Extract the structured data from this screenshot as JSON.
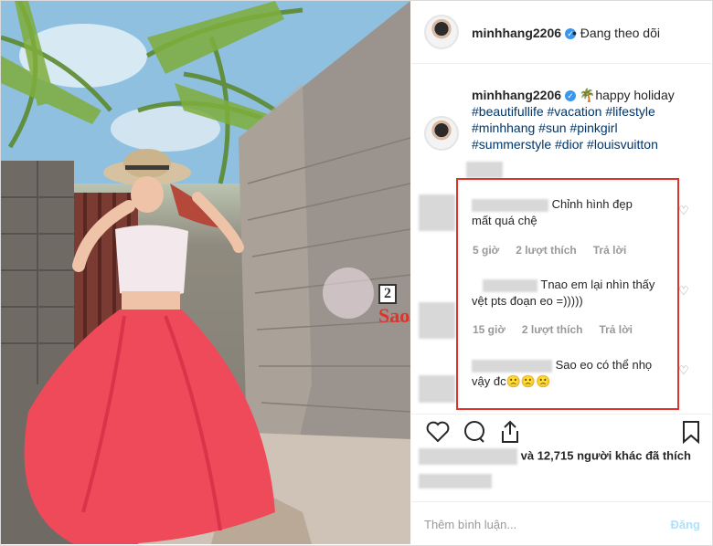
{
  "post": {
    "username": "minhhang2206",
    "follow_status": "• Đang theo dõi",
    "caption_prefix": "🌴happy holiday",
    "hashtags_line1": "#beautifullife #vacation #lifestyle",
    "hashtags_line2": "#minhhang #sun #pinkgirl",
    "hashtags_line3": "#summerstyle #dior #louisvuitton"
  },
  "comments": [
    {
      "text_line1": "Chỉnh hình đẹp",
      "text_line2": "mất quá chệ",
      "time": "5 giờ",
      "likes": "2 lượt thích",
      "reply": "Trả lời"
    },
    {
      "text_line1": "Tnao em lại nhìn thấy",
      "text_line2": "vệt pts đoạn eo =)))))",
      "time": "15 giờ",
      "likes": "2 lượt thích",
      "reply": "Trả lời"
    },
    {
      "text_line1": "Sao eo có thể nhọ",
      "text_line2": "vậy đc🙁🙁🙁"
    }
  ],
  "likes_text": "và 12,715 người khác đã thích",
  "add_comment_placeholder": "Thêm bình luận...",
  "post_button": "Đăng",
  "watermark": {
    "number": "2",
    "text": "Sao"
  },
  "colors": {
    "accent": "#3897f0",
    "highlight_box": "#e0342b",
    "skirt": "#ef4a5a"
  }
}
